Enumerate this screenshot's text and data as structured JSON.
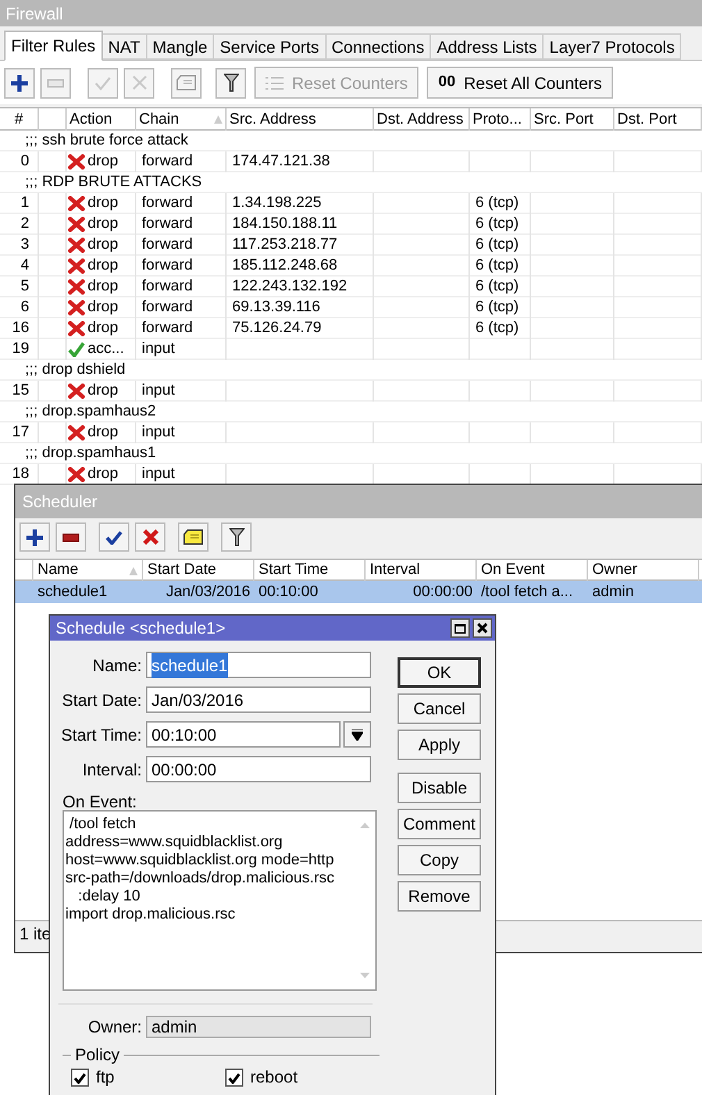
{
  "firewall": {
    "title": "Firewall",
    "tabs": [
      {
        "label": "Filter Rules",
        "selected": true
      },
      {
        "label": "NAT",
        "selected": false
      },
      {
        "label": "Mangle",
        "selected": false
      },
      {
        "label": "Service Ports",
        "selected": false
      },
      {
        "label": "Connections",
        "selected": false
      },
      {
        "label": "Address Lists",
        "selected": false
      },
      {
        "label": "Layer7 Protocols",
        "selected": false
      }
    ],
    "toolbar": [
      {
        "kind": "add",
        "disabled": false
      },
      {
        "kind": "remove",
        "disabled": true
      },
      {
        "kind": "enable",
        "disabled": true
      },
      {
        "kind": "disable",
        "disabled": true
      },
      {
        "kind": "comment",
        "disabled": true
      },
      {
        "kind": "filter",
        "disabled": false
      },
      {
        "kind": "reset",
        "label": "Reset Counters",
        "disabled": true
      },
      {
        "kind": "reset_all",
        "badge": "00",
        "label": "Reset All Counters",
        "disabled": false
      }
    ],
    "columns": [
      {
        "label": "#",
        "sorted": false
      },
      {
        "label": "Action",
        "sorted": false
      },
      {
        "label": "Chain",
        "sorted": true
      },
      {
        "label": "Src. Address",
        "sorted": false
      },
      {
        "label": "Dst. Address",
        "sorted": false
      },
      {
        "label": "Proto...",
        "sorted": false
      },
      {
        "label": "Src. Port",
        "sorted": false
      },
      {
        "label": "Dst. Port",
        "sorted": false
      }
    ],
    "rows": [
      {
        "kind": "comment",
        "text": ";;; ssh brute force attack"
      },
      {
        "kind": "drop",
        "number": "0",
        "action": "drop",
        "chain": "forward",
        "src": "174.47.121.38"
      },
      {
        "kind": "comment",
        "text": ";;; RDP BRUTE ATTACKS"
      },
      {
        "kind": "drop",
        "number": "1",
        "action": "drop",
        "chain": "forward",
        "src": "1.34.198.225",
        "protocol": "6 (tcp)"
      },
      {
        "kind": "drop",
        "number": "2",
        "action": "drop",
        "chain": "forward",
        "src": "184.150.188.11",
        "protocol": "6 (tcp)"
      },
      {
        "kind": "drop",
        "number": "3",
        "action": "drop",
        "chain": "forward",
        "src": "117.253.218.77",
        "protocol": "6 (tcp)"
      },
      {
        "kind": "drop",
        "number": "4",
        "action": "drop",
        "chain": "forward",
        "src": "185.112.248.68",
        "protocol": "6 (tcp)"
      },
      {
        "kind": "drop",
        "number": "5",
        "action": "drop",
        "chain": "forward",
        "src": "122.243.132.192",
        "protocol": "6 (tcp)"
      },
      {
        "kind": "drop",
        "number": "6",
        "action": "drop",
        "chain": "forward",
        "src": "69.13.39.116",
        "protocol": "6 (tcp)"
      },
      {
        "kind": "drop",
        "number": "16",
        "action": "drop",
        "chain": "forward",
        "src": "75.126.24.79",
        "protocol": "6 (tcp)"
      },
      {
        "kind": "accept",
        "number": "19",
        "action": "acc...",
        "chain": "input"
      },
      {
        "kind": "comment",
        "text": ";;; drop dshield"
      },
      {
        "kind": "drop",
        "number": "15",
        "action": "drop",
        "chain": "input"
      },
      {
        "kind": "comment",
        "text": ";;; drop.spamhaus2"
      },
      {
        "kind": "drop",
        "number": "17",
        "action": "drop",
        "chain": "input"
      },
      {
        "kind": "comment",
        "text": ";;; drop.spamhaus1"
      },
      {
        "kind": "drop",
        "number": "18",
        "action": "drop",
        "chain": "input"
      }
    ]
  },
  "scheduler": {
    "title": "Scheduler",
    "toolbar": [
      {
        "kind": "add"
      },
      {
        "kind": "remove"
      },
      {
        "kind": "enable"
      },
      {
        "kind": "disable"
      },
      {
        "kind": "comment"
      },
      {
        "kind": "filter"
      }
    ],
    "columns": [
      {
        "label": "Name",
        "sorted": true
      },
      {
        "label": "Start Date",
        "sorted": false
      },
      {
        "label": "Start Time",
        "sorted": false
      },
      {
        "label": "Interval",
        "sorted": false
      },
      {
        "label": "On Event",
        "sorted": false
      },
      {
        "label": "Owner",
        "sorted": false
      }
    ],
    "rows": [
      {
        "selected": true,
        "cells": [
          "schedule1",
          "Jan/03/2016",
          "00:10:00",
          "00:00:00",
          "/tool fetch a...",
          "admin"
        ]
      }
    ],
    "status": "1 ite"
  },
  "dialog": {
    "title": "Schedule <schedule1>",
    "fields": [
      {
        "label": "Name:",
        "value": "schedule1",
        "highlighted": true,
        "dropdown": false
      },
      {
        "label": "Start Date:",
        "value": "Jan/03/2016",
        "highlighted": false,
        "dropdown": false
      },
      {
        "label": "Start Time:",
        "value": "00:10:00",
        "highlighted": false,
        "dropdown": true
      },
      {
        "label": "Interval:",
        "value": "00:00:00",
        "highlighted": false,
        "dropdown": false
      }
    ],
    "on_event": {
      "label": "On Event:",
      "lines": [
        " /tool fetch",
        "address=www.squidblacklist.org",
        "host=www.squidblacklist.org mode=http",
        "src-path=/downloads/drop.malicious.rsc",
        "   :delay 10",
        "import drop.malicious.rsc"
      ]
    },
    "owner": {
      "label": "Owner:",
      "value": "admin"
    },
    "policy": {
      "title": "Policy",
      "items": [
        {
          "label": "ftp",
          "checked": true
        },
        {
          "label": "reboot",
          "checked": true
        }
      ]
    },
    "buttons": [
      {
        "label": "OK",
        "default": true
      },
      {
        "label": "Cancel",
        "default": false
      },
      {
        "label": "Apply",
        "default": false
      },
      {
        "label": "Disable",
        "default": false
      },
      {
        "label": "Comment",
        "default": false
      },
      {
        "label": "Copy",
        "default": false
      },
      {
        "label": "Remove",
        "default": false
      }
    ]
  }
}
